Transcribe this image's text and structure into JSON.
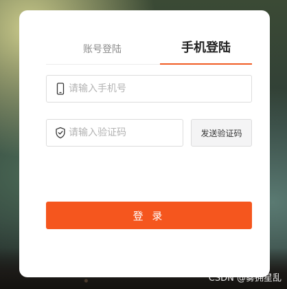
{
  "tabs": {
    "account_label": "账号登陆",
    "phone_label": "手机登陆",
    "active": "phone"
  },
  "phone_field": {
    "placeholder": "请输入手机号",
    "value": "",
    "icon": "mobile-phone-icon"
  },
  "code_field": {
    "placeholder": "请输入验证码",
    "value": "",
    "icon": "shield-check-icon"
  },
  "send_code_label": "发送验证码",
  "login_label": "登 录",
  "watermark": "CSDN @雾拥星乱",
  "colors": {
    "accent": "#f5561e",
    "tab_underline": "#f05a22"
  }
}
